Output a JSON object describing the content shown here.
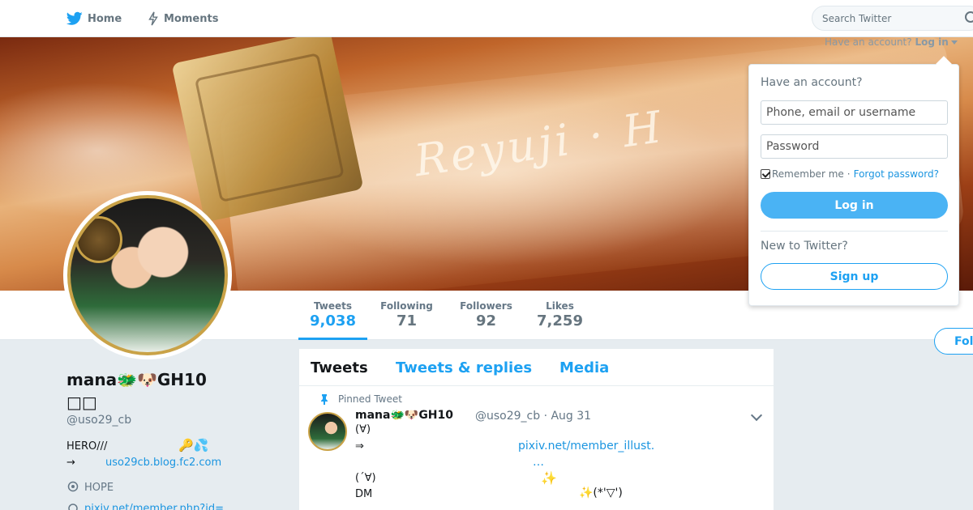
{
  "nav": {
    "home_label": "Home",
    "moments_label": "Moments",
    "search_placeholder": "Search Twitter",
    "home_icon": "twitter-bird-icon",
    "moments_icon": "lightning-icon",
    "search_icon": "magnifier-icon"
  },
  "login_toggle": {
    "prompt": "Have an account?",
    "label": "Log in"
  },
  "login_panel": {
    "heading": "Have an account?",
    "username_placeholder": "Phone, email or username",
    "password_placeholder": "Password",
    "remember_label": "Remember me",
    "separator": "·",
    "forgot_label": "Forgot password?",
    "remember_checked": true,
    "login_button": "Log in",
    "new_heading": "New to Twitter?",
    "signup_button": "Sign up"
  },
  "profile": {
    "name": "mana🐲🐶GH10\u0000\u0000\u0000\u0000\u0000",
    "name_display_line1": "mana🐲🐶GH10",
    "name_display_line2": "",
    "handle": "@uso29_cb",
    "bio_line1": "HERO///",
    "bio_emoji": "🔑💦",
    "bio_arrow": "→",
    "bio_link": "uso29cb.blog.fc2.com",
    "location": "HOPE",
    "url": "pixiv.net/member.php?id="
  },
  "stats": [
    {
      "label": "Tweets",
      "value": "9,038"
    },
    {
      "label": "Following",
      "value": "71"
    },
    {
      "label": "Followers",
      "value": "92"
    },
    {
      "label": "Likes",
      "value": "7,259"
    }
  ],
  "follow_button": "Follow",
  "timeline": {
    "tabs": [
      "Tweets",
      "Tweets & replies",
      "Media"
    ],
    "pinned_label": "Pinned Tweet",
    "tweet": {
      "name": "mana🐲🐶GH10",
      "handle_date": "@uso29_cb · Aug 31",
      "line1": "(∀)",
      "line2": "⇒",
      "link1": "pixiv.net/member_illust.",
      "ellipsis": "…",
      "line3": "(´∀)",
      "line4": "DM",
      "sparkle1": "✨",
      "sparkle2": "✨(*'▽')"
    }
  },
  "colors": {
    "accent": "#1da1f2",
    "link": "#1b95e0",
    "nav_bg": "#ffffff",
    "page_bg": "#e6ecf0"
  }
}
